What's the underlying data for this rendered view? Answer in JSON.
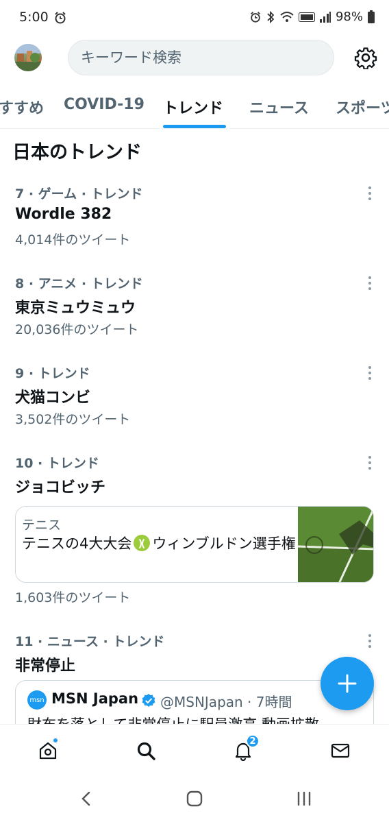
{
  "status_bar": {
    "time": "5:00",
    "battery": "98%"
  },
  "header": {
    "search_placeholder": "キーワード検索"
  },
  "tabs": [
    {
      "label": "すすめ",
      "active": false
    },
    {
      "label": "COVID-19",
      "active": false
    },
    {
      "label": "トレンド",
      "active": true
    },
    {
      "label": "ニュース",
      "active": false
    },
    {
      "label": "スポーツ",
      "active": false
    }
  ],
  "section": {
    "title": "日本のトレンド"
  },
  "trends": [
    {
      "meta": "7 · ゲーム · トレンド",
      "name": "Wordle 382",
      "count": "4,014件のツイート"
    },
    {
      "meta": "8 · アニメ · トレンド",
      "name": "東京ミュウミュウ",
      "count": "20,036件のツイート"
    },
    {
      "meta": "9 · トレンド",
      "name": "犬猫コンビ",
      "count": "3,502件のツイート"
    },
    {
      "meta": "10 · トレンド",
      "name": "ジョコビッチ",
      "count": "1,603件のツイート"
    },
    {
      "meta": "11 · ニュース · トレンド",
      "name": "非常停止",
      "count": ""
    }
  ],
  "news_card": {
    "category": "テニス",
    "title_before": "テニスの4大大会",
    "title_after": "ウィンブルドン選手権"
  },
  "tweet": {
    "logo_text": "msn",
    "name": "MSN Japan",
    "handle": "@MSNJapan · 7時間",
    "body": "財布を落として非常停止に駅員激高 動画拡散"
  },
  "bottom_nav": {
    "notifications_count": "2"
  },
  "colors": {
    "accent": "#1d9bf0",
    "text": "#0f1419",
    "secondary": "#536471"
  }
}
